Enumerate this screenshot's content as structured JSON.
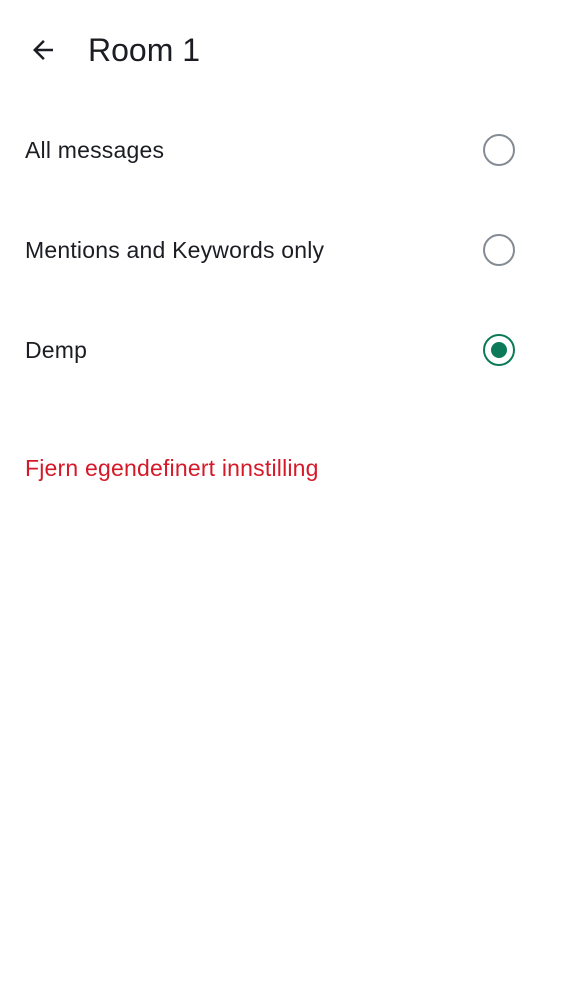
{
  "header": {
    "title": "Room 1",
    "back_icon": "arrow-left-icon"
  },
  "options": [
    {
      "label": "All messages",
      "selected": false
    },
    {
      "label": "Mentions and Keywords only",
      "selected": false
    },
    {
      "label": "Demp",
      "selected": true
    }
  ],
  "reset": {
    "label": "Fjern egendefinert innstilling"
  },
  "colors": {
    "accent": "#0c7a58",
    "danger": "#d51928",
    "radio_border": "#858b94",
    "text": "#1b1d22"
  }
}
